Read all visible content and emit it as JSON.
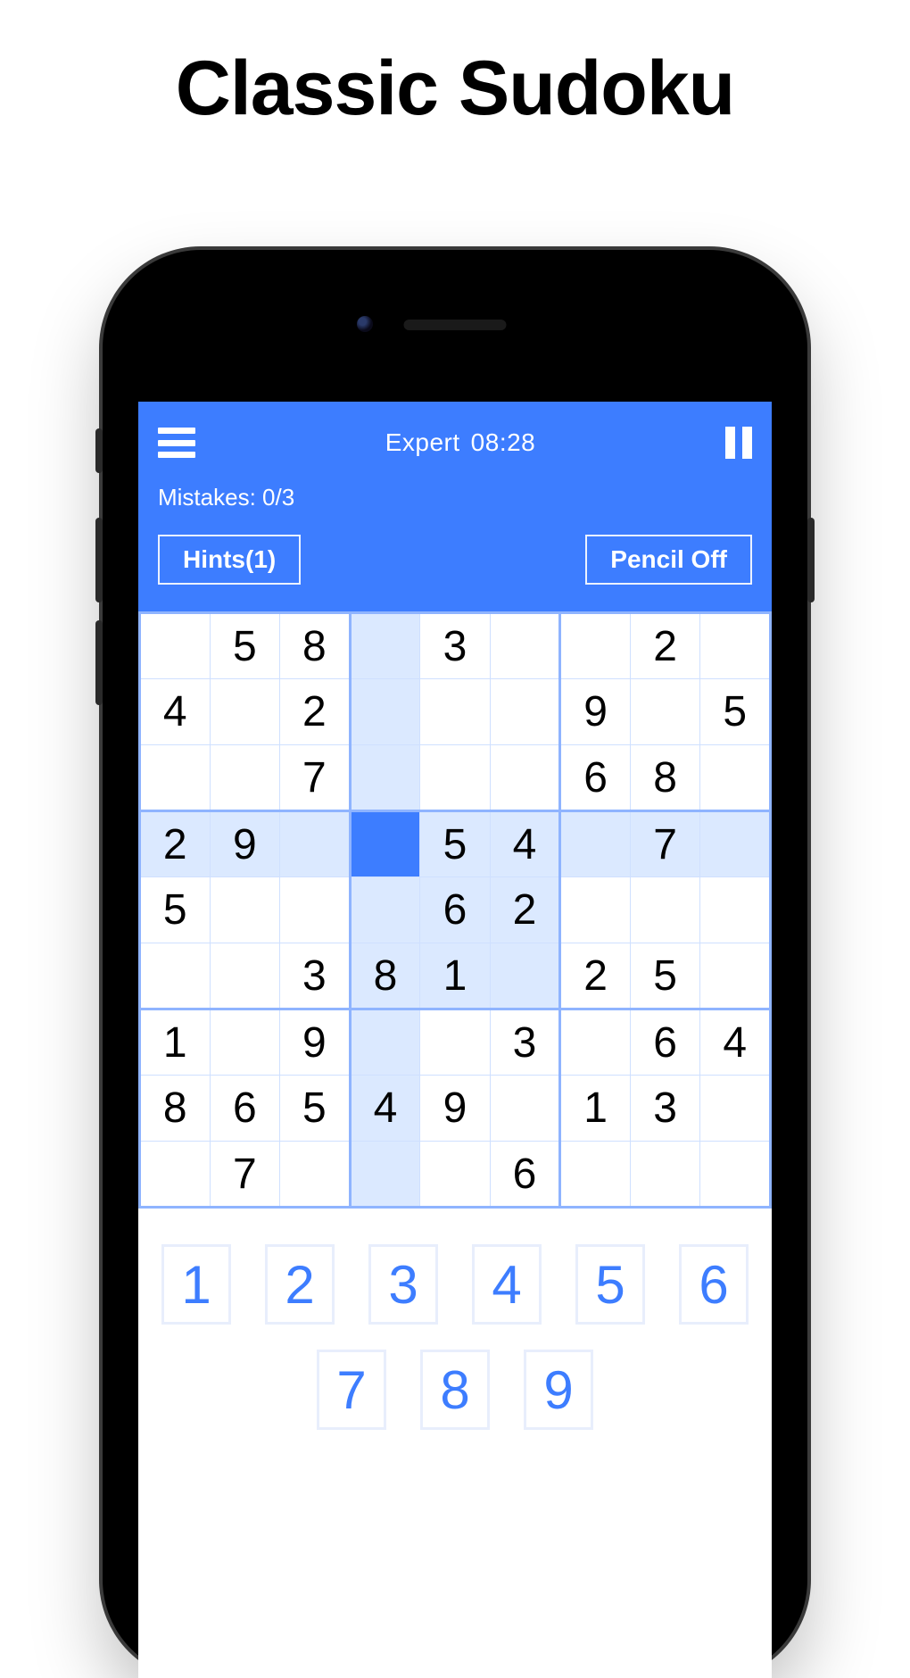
{
  "title": "Classic Sudoku",
  "header": {
    "difficulty": "Expert",
    "time": "08:28",
    "mistakes_label": "Mistakes: 0/3",
    "hints_label": "Hints(1)",
    "pencil_label": "Pencil Off"
  },
  "board": {
    "selected": [
      3,
      3
    ],
    "highlight_row": 3,
    "highlight_col": 3,
    "highlight_box": [
      3,
      3
    ],
    "cells": [
      [
        {
          "v": ""
        },
        {
          "v": "5"
        },
        {
          "v": "8"
        },
        {
          "v": ""
        },
        {
          "v": "3"
        },
        {
          "v": ""
        },
        {
          "v": ""
        },
        {
          "v": "2"
        },
        {
          "v": ""
        }
      ],
      [
        {
          "v": "4"
        },
        {
          "v": ""
        },
        {
          "v": "2",
          "u": true
        },
        {
          "v": ""
        },
        {
          "v": ""
        },
        {
          "v": ""
        },
        {
          "v": "9"
        },
        {
          "v": ""
        },
        {
          "v": "5",
          "u": true
        }
      ],
      [
        {
          "v": ""
        },
        {
          "v": ""
        },
        {
          "v": "7"
        },
        {
          "v": ""
        },
        {
          "v": ""
        },
        {
          "v": ""
        },
        {
          "v": "6"
        },
        {
          "v": "8"
        },
        {
          "v": ""
        }
      ],
      [
        {
          "v": "2"
        },
        {
          "v": "9"
        },
        {
          "v": ""
        },
        {
          "v": ""
        },
        {
          "v": "5",
          "u": true
        },
        {
          "v": "4"
        },
        {
          "v": ""
        },
        {
          "v": "7"
        },
        {
          "v": ""
        }
      ],
      [
        {
          "v": "5"
        },
        {
          "v": ""
        },
        {
          "v": ""
        },
        {
          "v": ""
        },
        {
          "v": "6"
        },
        {
          "v": "2"
        },
        {
          "v": ""
        },
        {
          "v": ""
        },
        {
          "v": ""
        }
      ],
      [
        {
          "v": ""
        },
        {
          "v": ""
        },
        {
          "v": "3"
        },
        {
          "v": "8"
        },
        {
          "v": "1"
        },
        {
          "v": ""
        },
        {
          "v": "2"
        },
        {
          "v": "5"
        },
        {
          "v": ""
        }
      ],
      [
        {
          "v": "1"
        },
        {
          "v": ""
        },
        {
          "v": "9"
        },
        {
          "v": ""
        },
        {
          "v": ""
        },
        {
          "v": "3"
        },
        {
          "v": ""
        },
        {
          "v": "6",
          "u": true
        },
        {
          "v": "4"
        }
      ],
      [
        {
          "v": "8",
          "u": true
        },
        {
          "v": "6"
        },
        {
          "v": "5"
        },
        {
          "v": "4"
        },
        {
          "v": "9"
        },
        {
          "v": ""
        },
        {
          "v": "1"
        },
        {
          "v": "3"
        },
        {
          "v": ""
        }
      ],
      [
        {
          "v": ""
        },
        {
          "v": "7"
        },
        {
          "v": ""
        },
        {
          "v": ""
        },
        {
          "v": ""
        },
        {
          "v": "6"
        },
        {
          "v": ""
        },
        {
          "v": ""
        },
        {
          "v": ""
        }
      ]
    ]
  },
  "keypad": [
    "1",
    "2",
    "3",
    "4",
    "5",
    "6",
    "7",
    "8",
    "9"
  ]
}
